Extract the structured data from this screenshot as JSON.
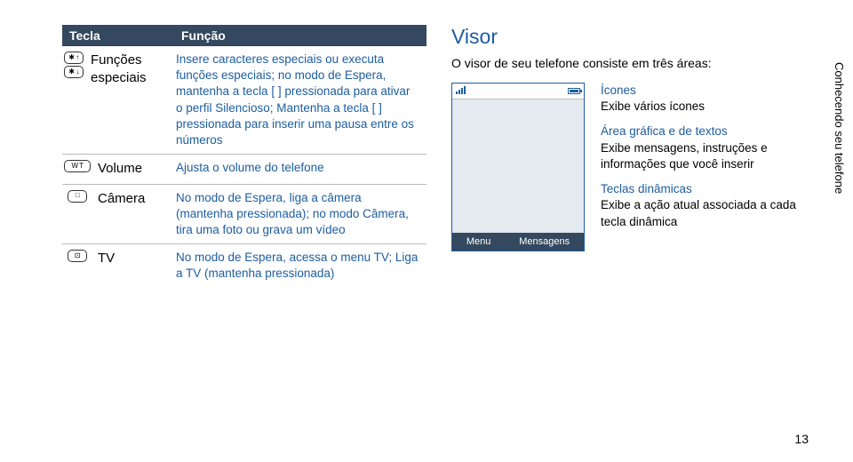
{
  "table": {
    "headers": {
      "key": "Tecla",
      "func": "Função"
    },
    "rows": [
      {
        "icons": [
          "✱ ↑",
          "✱ ↓"
        ],
        "label": "Funções especiais",
        "desc": "Insere caracteres especiais ou executa funções especiais; no modo de Espera, mantenha a tecla [ ] pressionada para ativar o perfil Silencioso; Mantenha a tecla [ ] pressionada para inserir uma pausa entre os números"
      },
      {
        "icons": [
          "W  T"
        ],
        "iconWide": true,
        "label": "Volume",
        "desc": "Ajusta o volume do telefone"
      },
      {
        "icons": [
          "□"
        ],
        "label": "Câmera",
        "desc": "No modo de Espera, liga a câmera (mantenha pressionada); no modo Câmera, tira uma foto ou grava um vídeo"
      },
      {
        "icons": [
          "⊡"
        ],
        "label": "TV",
        "desc": "No modo de Espera, acessa o menu TV; Liga a TV (mantenha pressionada)"
      }
    ]
  },
  "visor": {
    "title": "Visor",
    "intro": "O visor de seu telefone consiste em três áreas:",
    "softkeys": {
      "left": "Menu",
      "right": "Mensagens"
    },
    "legend": [
      {
        "head": "Ícones",
        "desc": "Exibe vários ícones"
      },
      {
        "head": "Área gráfica e de textos",
        "desc": "Exibe mensagens, instruções e informações que você inserir"
      },
      {
        "head": "Teclas dinâmicas",
        "desc": "Exibe a ação atual associada a cada tecla dinâmica"
      }
    ]
  },
  "side_tab": "Conhecendo seu telefone",
  "page_number": "13"
}
